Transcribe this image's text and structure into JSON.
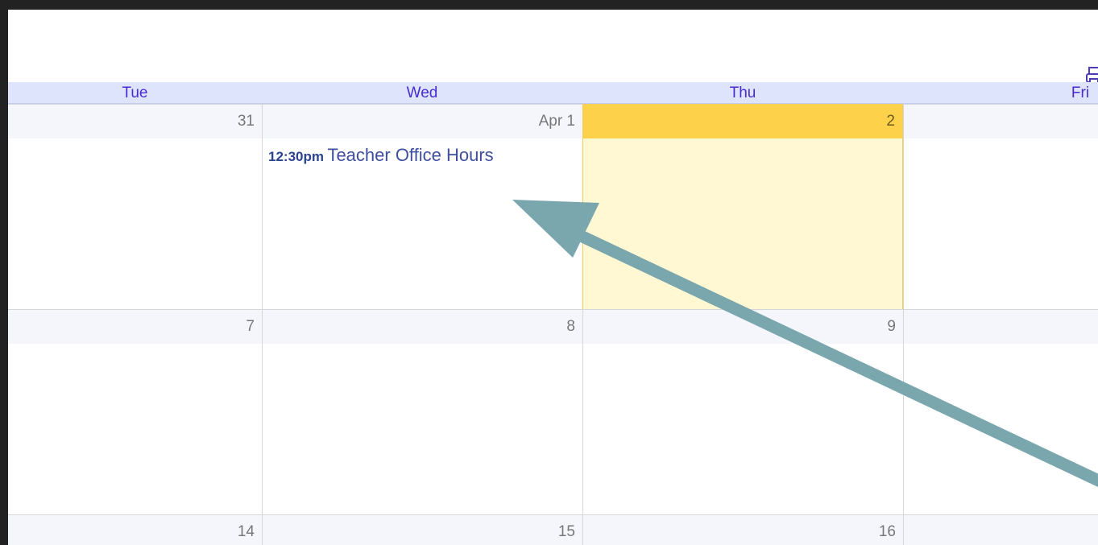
{
  "calendar": {
    "weekdays": [
      "Tue",
      "Wed",
      "Thu",
      "Fri"
    ],
    "weeks": [
      {
        "dates": [
          "31",
          "Apr 1",
          "2",
          ""
        ]
      },
      {
        "dates": [
          "7",
          "8",
          "9",
          ""
        ]
      },
      {
        "dates": [
          "14",
          "15",
          "16",
          ""
        ]
      }
    ],
    "today_label": "2",
    "events": [
      {
        "time": "12:30pm",
        "title": "Teacher Office Hours"
      }
    ]
  },
  "toolbar": {
    "print_icon": "print-icon"
  },
  "colors": {
    "header_bg": "#dde4fb",
    "weekday_text": "#4a2bd0",
    "today_bar": "#fdd24a",
    "today_bg": "#fff8d3",
    "event_text": "#3f4f9f",
    "arrow": "#7aa6ae"
  }
}
